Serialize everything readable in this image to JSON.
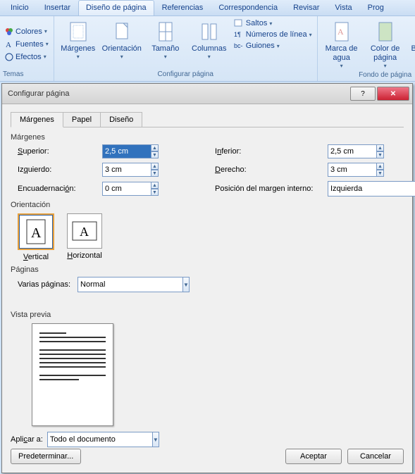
{
  "ribbon": {
    "tabs": [
      "Inicio",
      "Insertar",
      "Diseño de página",
      "Referencias",
      "Correspondencia",
      "Revisar",
      "Vista",
      "Prog"
    ],
    "active": 2,
    "themes_group": {
      "label": "Temas",
      "colors": "Colores",
      "fonts": "Fuentes",
      "effects": "Efectos"
    },
    "pagesetup_group": {
      "label": "Configurar página",
      "margins": "Márgenes",
      "orientation": "Orientación",
      "size": "Tamaño",
      "columns": "Columnas",
      "breaks": "Saltos",
      "linenums": "Números de línea",
      "hyphen": "Guiones"
    },
    "bg_group": {
      "label": "Fondo de página",
      "watermark": "Marca de agua",
      "pagecolor": "Color de página",
      "borders": "Bordes de página"
    }
  },
  "dialog": {
    "title": "Configurar página",
    "tabs": [
      "Márgenes",
      "Papel",
      "Diseño"
    ],
    "activeTab": 0,
    "section_margins": "Márgenes",
    "labels": {
      "top": "Superior:",
      "bottom": "Inferior:",
      "left": "Izquierdo:",
      "right": "Derecho:",
      "gutter": "Encuadernación:",
      "gutterpos": "Posición del margen interno:"
    },
    "values": {
      "top": "2,5 cm",
      "bottom": "2,5 cm",
      "left": "3 cm",
      "right": "3 cm",
      "gutter": "0 cm",
      "gutterpos": "Izquierda"
    },
    "section_orient": "Orientación",
    "orient": {
      "portrait": "Vertical",
      "landscape": "Horizontal",
      "selected": "portrait"
    },
    "section_pages": "Páginas",
    "multipages": {
      "label": "Varias páginas:",
      "value": "Normal"
    },
    "section_preview": "Vista previa",
    "apply": {
      "label": "Aplicar a:",
      "value": "Todo el documento"
    },
    "buttons": {
      "default": "Predeterminar...",
      "ok": "Aceptar",
      "cancel": "Cancelar"
    }
  }
}
